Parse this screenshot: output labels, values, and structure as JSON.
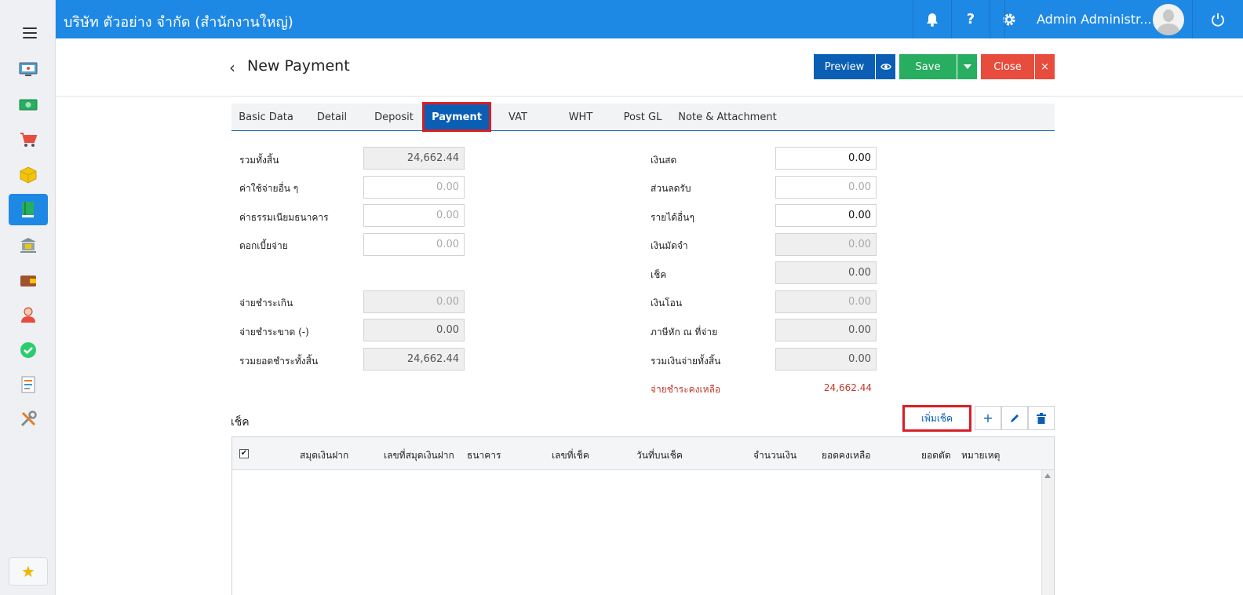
{
  "topbar": {
    "company": "บริษัท ตัวอย่าง จำกัด (สำนักงานใหญ่)",
    "user_name": "Admin Administr...",
    "icons": [
      "bell-icon",
      "help-icon",
      "gear-icon",
      "power-icon"
    ],
    "color": "#1e88e5"
  },
  "page": {
    "title": "New Payment",
    "buttons": {
      "preview": "Preview",
      "save": "Save",
      "close": "Close",
      "close_x": "×"
    }
  },
  "tabs": [
    {
      "label": "Basic Data"
    },
    {
      "label": "Detail"
    },
    {
      "label": "Deposit"
    },
    {
      "label": "Payment",
      "active": true
    },
    {
      "label": "VAT"
    },
    {
      "label": "WHT"
    },
    {
      "label": "Post GL"
    },
    {
      "label": "Note & Attachment"
    }
  ],
  "left_form": {
    "total": {
      "label": "รวมทั้งสิ้น",
      "value": "24,662.44"
    },
    "other_expense": {
      "label": "ค่าใช้จ่ายอื่น ๆ",
      "placeholder": "0.00"
    },
    "bank_fee": {
      "label": "ค่าธรรมเนียมธนาคาร",
      "placeholder": "0.00"
    },
    "interest": {
      "label": "ดอกเบี้ยจ่าย",
      "placeholder": "0.00"
    },
    "overpay": {
      "label": "จ่ายชำระเกิน",
      "placeholder": "0.00"
    },
    "underpay": {
      "label": "จ่ายชำระขาด (-)",
      "value": "0.00"
    },
    "total_paid": {
      "label": "รวมยอดชำระทั้งสิ้น",
      "value": "24,662.44"
    }
  },
  "right_form": {
    "cash": {
      "label": "เงินสด",
      "value": "0.00"
    },
    "discount": {
      "label": "ส่วนลดรับ",
      "placeholder": "0.00"
    },
    "other_income": {
      "label": "รายได้อื่นๆ",
      "value": "0.00"
    },
    "deposit": {
      "label": "เงินมัดจำ",
      "placeholder": "0.00"
    },
    "cheque": {
      "label": "เช็ค",
      "value": "0.00"
    },
    "transfer": {
      "label": "เงินโอน",
      "placeholder": "0.00"
    },
    "wht": {
      "label": "ภาษีหัก ณ ที่จ่าย",
      "value": "0.00"
    },
    "total_payment": {
      "label": "รวมเงินจ่ายทั้งสิ้น",
      "value": "0.00"
    },
    "remaining": {
      "label": "จ่ายชำระคงเหลือ",
      "value": "24,662.44"
    }
  },
  "cheque_section": {
    "title": "เช็ค",
    "add_button": "เพิ่มเช็ค",
    "columns": [
      "สมุดเงินฝาก",
      "เลขที่สมุดเงินฝาก",
      "ธนาคาร",
      "เลขที่เช็ค",
      "วันที่บนเช็ค",
      "จำนวนเงิน",
      "ยอดคงเหลือ",
      "ยอดตัด",
      "หมายเหตุ"
    ],
    "rows": []
  }
}
